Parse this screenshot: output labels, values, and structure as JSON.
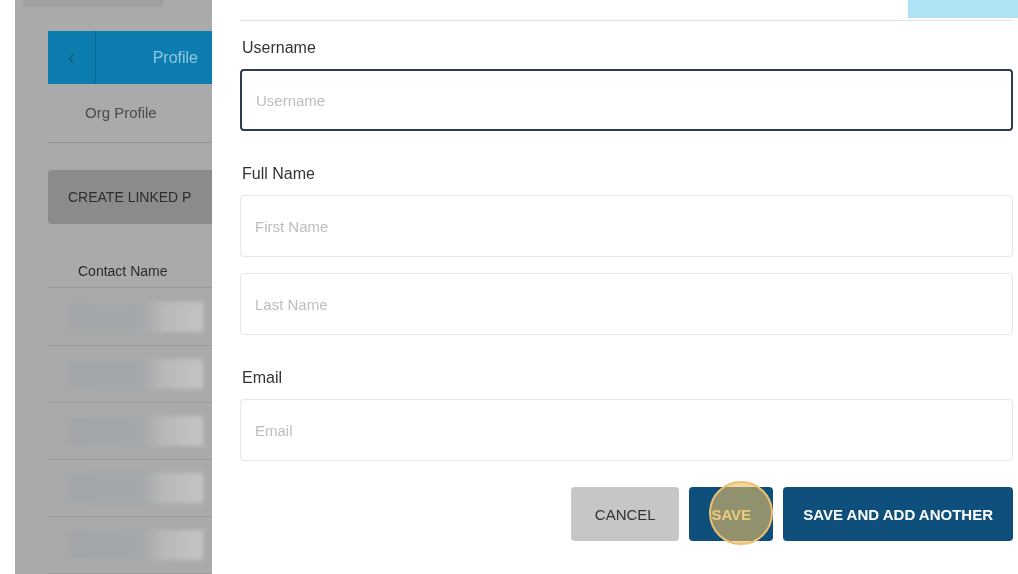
{
  "background": {
    "header": {
      "back_icon": "‹",
      "title": "Profile"
    },
    "nav_item": "Org Profile",
    "create_button": "CREATE LINKED P",
    "table": {
      "column": "Contact Name",
      "rows": [
        {
          "redacted": true
        },
        {
          "redacted": true
        },
        {
          "redacted": true
        },
        {
          "redacted": true
        },
        {
          "redacted": true
        }
      ]
    }
  },
  "form": {
    "fields": [
      {
        "label": "Username",
        "inputs": [
          {
            "placeholder": "Username",
            "focused": true
          }
        ]
      },
      {
        "label": "Full Name",
        "inputs": [
          {
            "placeholder": "First Name",
            "focused": false
          },
          {
            "placeholder": "Last Name",
            "focused": false
          }
        ]
      },
      {
        "label": "Email",
        "inputs": [
          {
            "placeholder": "Email",
            "focused": false
          }
        ]
      }
    ],
    "buttons": [
      {
        "label": "CANCEL",
        "kind": "secondary",
        "clicked": false
      },
      {
        "label": "SAVE",
        "kind": "primary",
        "clicked": true
      },
      {
        "label": "SAVE AND ADD ANOTHER",
        "kind": "primary",
        "clicked": false
      }
    ]
  }
}
